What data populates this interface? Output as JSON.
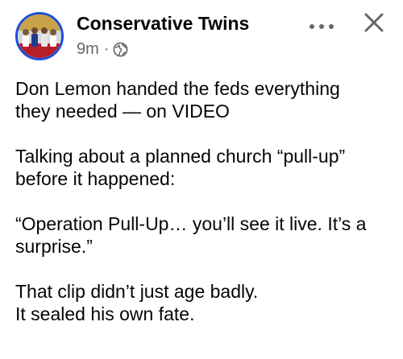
{
  "post": {
    "author": "Conservative Twins",
    "time": "9m",
    "separator": "·",
    "privacy_icon": "globe-icon",
    "actions": {
      "more_icon": "more-horizontal-icon",
      "close_icon": "close-icon"
    },
    "paragraphs": [
      "Don Lemon handed the feds everything\nthey needed — on VIDEO",
      "Talking about a planned church “pull-up”\nbefore it happened:",
      "“Operation Pull-Up… you’ll see it live. It’s a\nsurprise.”",
      "That clip didn’t just age badly.\nIt sealed his own fate."
    ]
  },
  "colors": {
    "text_primary": "#050505",
    "text_secondary": "#65676b",
    "avatar_ring": "#1d4ed8",
    "background": "#ffffff"
  }
}
